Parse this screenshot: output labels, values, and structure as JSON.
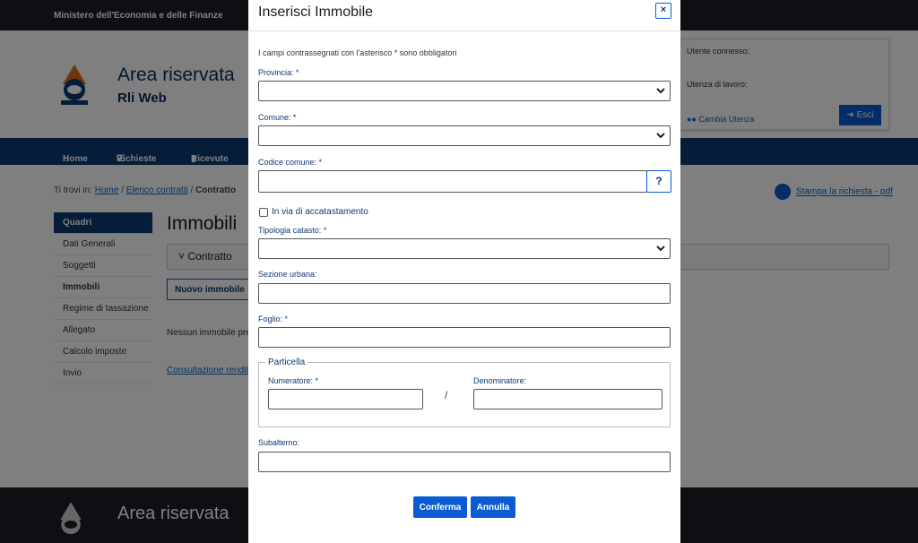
{
  "background": {
    "ministry": "Ministero dell'Economia e delle Finanze",
    "brand_title": "Area riservata",
    "brand_subtitle": "Rli Web",
    "user_box": {
      "utente_label": "Utente connesso:",
      "utenza_label": "Utenza di lavoro:",
      "cambia_label": "Cambia Utenza",
      "esci_label": "Esci"
    },
    "nav": {
      "home": "Home",
      "richieste": "Richieste",
      "ricevute": "Ricevute"
    },
    "breadcrumb": {
      "prefix": "Ti trovi in:",
      "home": "Home",
      "sep1": "/",
      "elenco": "Elenco contratti",
      "sep2": "/",
      "current": "Contratto"
    },
    "stampa_label": "Stampa la richiesta - pdf",
    "side_menu": [
      "Quadri",
      "Dati Generali",
      "Soggetti",
      "Immobili",
      "Regime di tassazione",
      "Allegato",
      "Calcolo imposte",
      "Invio"
    ],
    "page_heading": "Immobili",
    "contratto_label": "Contratto",
    "nuovo_label": "Nuovo immobile",
    "nessun_text": "Nessun immobile pre",
    "consultazione_text": "Consultazione rendite",
    "footer_title": "Area riservata"
  },
  "modal": {
    "title": "Inserisci Immobile",
    "close_label": "×",
    "note": "I campi contrassegnati con l'asterisco * sono obbligatori",
    "provincia_label": "Provincia: *",
    "comune_label": "Comune: *",
    "codice_label": "Codice comune: *",
    "help_label": "?",
    "accatastamento_label": "In via di accatastamento",
    "tipologia_label": "Tipologia catasto: *",
    "sezione_label": "Sezione urbana:",
    "foglio_label": "Foglio: *",
    "particella_legend": "Particella",
    "numeratore_label": "Numeratore: *",
    "slash": "/",
    "denominatore_label": "Denominatore:",
    "subalterno_label": "Subalterno:",
    "conferma_label": "Conferma",
    "annulla_label": "Annulla"
  },
  "colors": {
    "primary": "#0b5bd3",
    "navy": "#0b3a72",
    "overlay": "rgba(0,0,0,0.5)"
  }
}
